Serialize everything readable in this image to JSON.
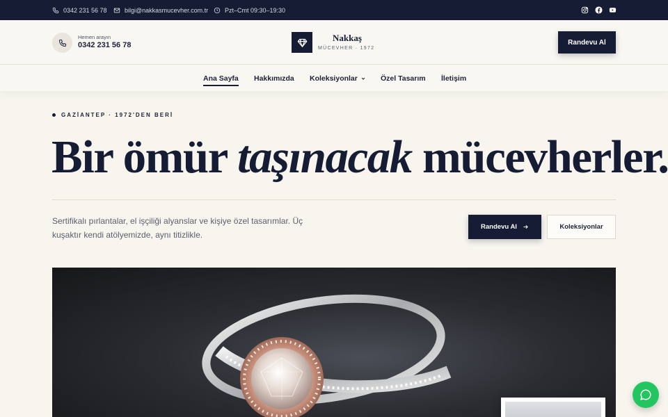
{
  "topbar": {
    "phone": "0342 231 56 78",
    "email": "bilgi@nakkasmucevher.com.tr",
    "hours": "Pzt–Cmt 09:30–19:30",
    "social_icons": [
      "instagram-icon",
      "facebook-icon",
      "youtube-icon"
    ]
  },
  "header": {
    "call_label": "Hemen arayın",
    "call_number": "0342 231 56 78",
    "brand_name": "Nakkaş",
    "brand_sub": "MÜCEVHER · 1972",
    "cta_label": "Randevu Al"
  },
  "nav": {
    "items": [
      {
        "label": "Ana Sayfa",
        "active": true
      },
      {
        "label": "Hakkımızda",
        "active": false
      },
      {
        "label": "Koleksiyonlar",
        "active": false,
        "has_dropdown": true
      },
      {
        "label": "Özel Tasarım",
        "active": false
      },
      {
        "label": "İletişim",
        "active": false
      }
    ]
  },
  "hero": {
    "eyebrow": "GAZİANTEP · 1972'DEN BERİ",
    "headline_start": "Bir ömür ",
    "headline_italic": "taşınacak",
    "headline_end": " mücevherler.",
    "description": "Sertifikalı pırlantalar, el işçiliği alyanslar ve kişiye özel tasarımlar. Üç kuşaktır kendi atölyemizde, aynı titizlikle.",
    "primary_cta": "Randevu Al",
    "secondary_cta": "Koleksiyonlar"
  },
  "colors": {
    "navy": "#151c33",
    "cream": "#f8f5ef",
    "whatsapp": "#22c55e"
  }
}
